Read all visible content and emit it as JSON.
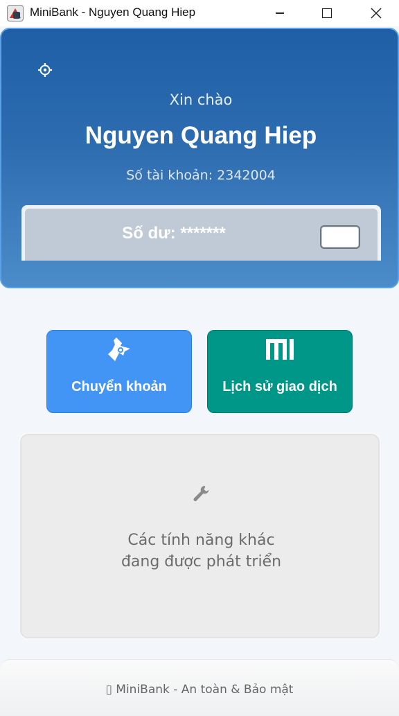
{
  "window": {
    "title": "MiniBank - Nguyen Quang Hiep"
  },
  "header": {
    "greeting": "Xin chào",
    "user_name": "Nguyen Quang Hiep",
    "account_label": "Số tài khoản: 2342004",
    "balance_label": "Số dư: *******"
  },
  "actions": {
    "transfer_label": "Chuyển khoản",
    "history_label": "Lịch sử giao dịch"
  },
  "coming_soon": {
    "text": "Các tính năng khác đang được phát triển"
  },
  "footer": {
    "text": "▯ MiniBank - An toàn & Bảo mật"
  },
  "icons": {
    "settings": "gear-icon",
    "transfer": "transfer-icon",
    "history": "history-icon",
    "tools": "wrench-icon",
    "balance_toggle": "toggle-icon"
  },
  "colors": {
    "header_top": "#1e5fa6",
    "header_bottom": "#4b8cc9",
    "transfer_tile": "#4294f5",
    "history_tile": "#009688",
    "background": "#f3f7fc"
  }
}
